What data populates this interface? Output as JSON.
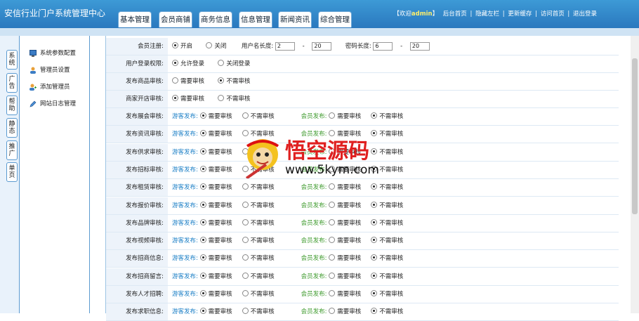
{
  "header": {
    "title": "安信行业门户系统管理中心",
    "tabs": [
      "基本管理",
      "会员商铺",
      "商务信息",
      "信息管理",
      "新闻资讯",
      "综合管理"
    ],
    "welcome_prefix": "【欢迎",
    "username": "admin",
    "welcome_suffix": "】",
    "links": [
      "后台首页",
      "隐藏左栏",
      "更新缓存",
      "访问首页",
      "退出登录"
    ]
  },
  "side_tabs": [
    "系统",
    "广告",
    "帮助",
    "静态",
    "推广",
    "单页"
  ],
  "menu": {
    "items": [
      {
        "label": "系统参数配置",
        "icon": "monitor-icon"
      },
      {
        "label": "管理员设置",
        "icon": "admin-user-icon"
      },
      {
        "label": "添加管理员",
        "icon": "add-user-icon"
      },
      {
        "label": "网站日志管理",
        "icon": "pencil-icon"
      }
    ]
  },
  "form": {
    "reg": {
      "label": "会员注册:",
      "on": "开启",
      "off": "关闭",
      "username_len_label": "用户名长度:",
      "username_min": "2",
      "username_max": "20",
      "password_len_label": "密码长度:",
      "password_min": "6",
      "password_max": "20",
      "dash": "-"
    },
    "login": {
      "label": "用户登录权限:",
      "allow": "允许登录",
      "deny": "关闭登录"
    },
    "goods": {
      "label": "发布商品审核:",
      "need": "需要审核",
      "noneed": "不需审核"
    },
    "shop": {
      "label": "商家开店审核:",
      "need": "需要审核",
      "noneed": "不需审核"
    },
    "guest_label": "游客发布:",
    "member_label": "会员发布:",
    "need": "需要审核",
    "noneed": "不需审核",
    "dual_rows": [
      "发布展会审核:",
      "发布资讯审核:",
      "发布供求审核:",
      "发布招标审核:",
      "发布租赁审核:",
      "发布报价审核:",
      "发布品牌审核:",
      "发布视频审核:",
      "发布招商信息:",
      "发布招商留言:",
      "发布人才招聘:",
      "发布求职信息:"
    ]
  },
  "watermark": {
    "title": "悟空源码",
    "url": "www.5kym.com"
  }
}
